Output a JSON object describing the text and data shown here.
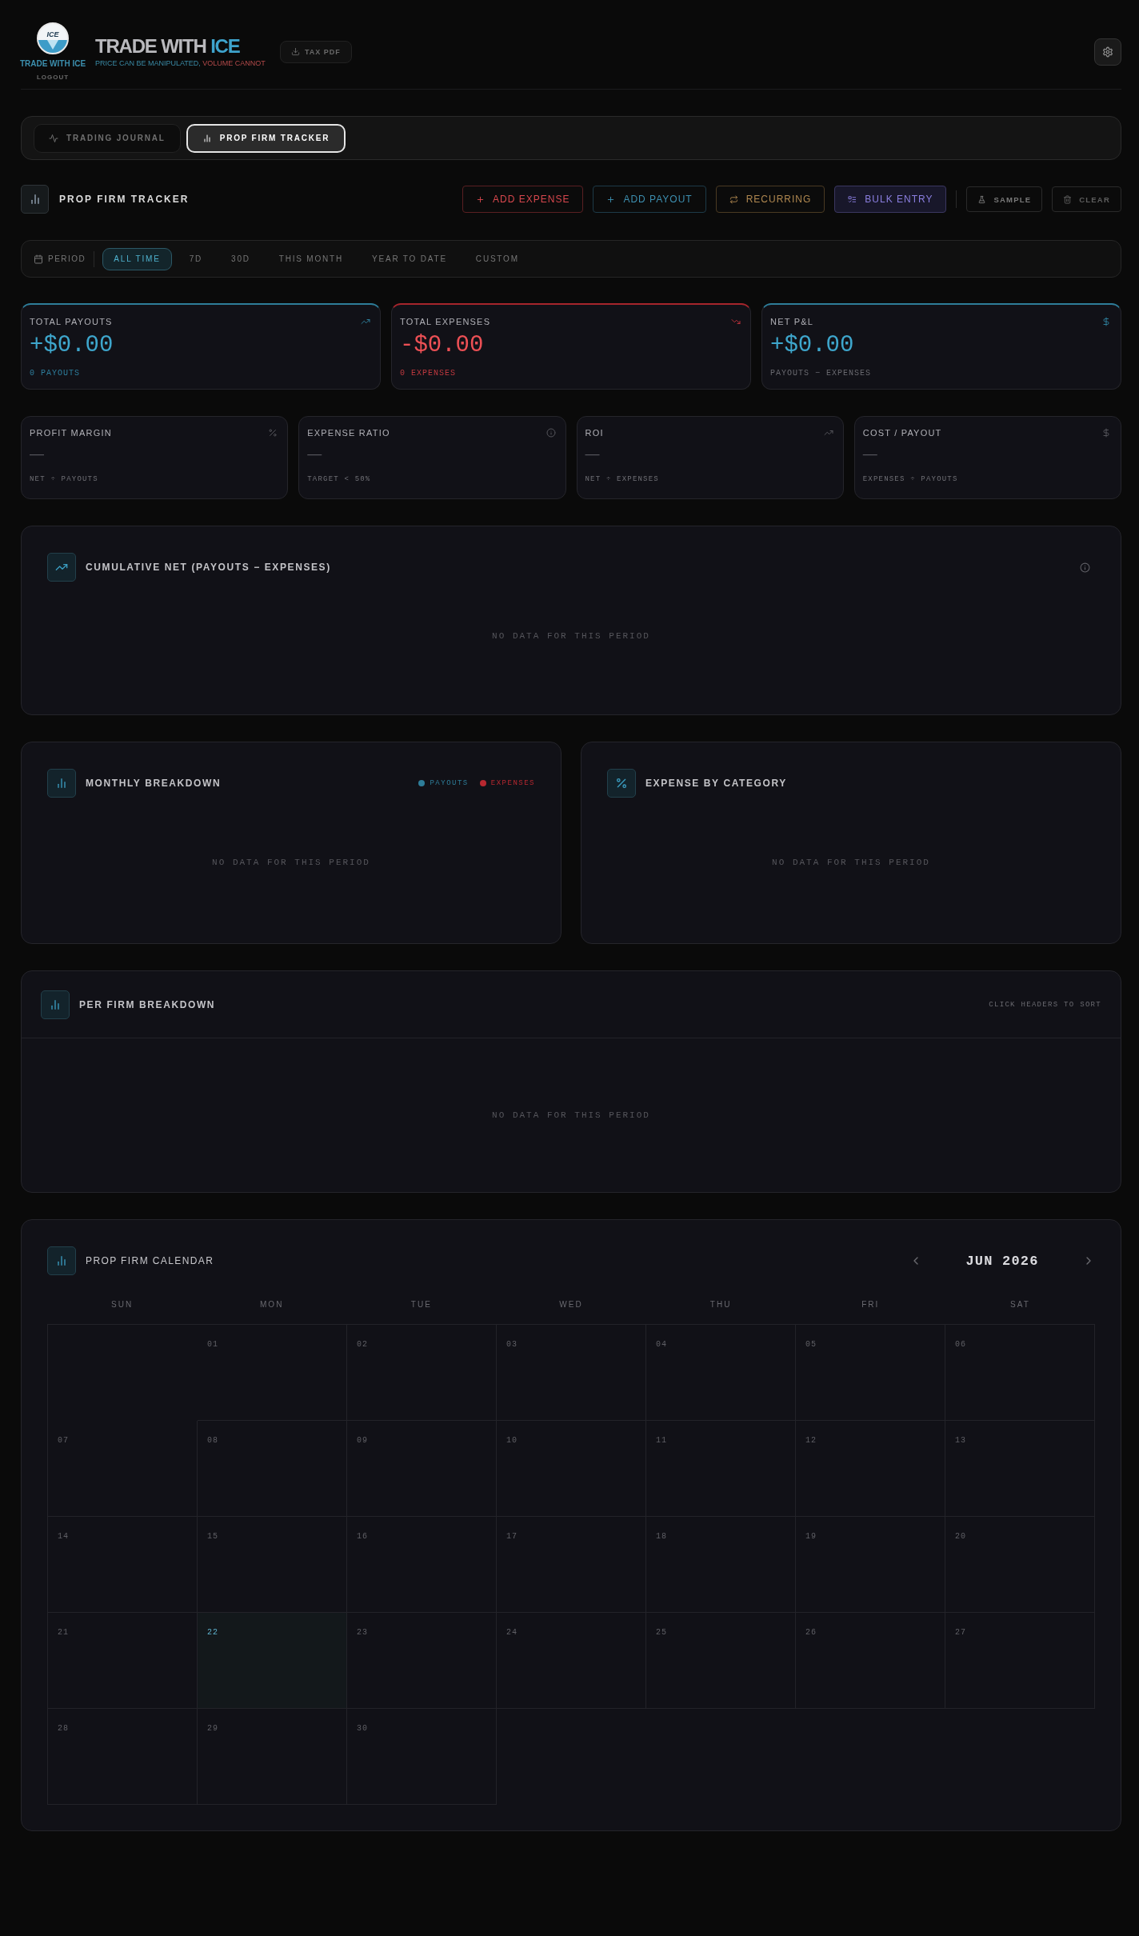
{
  "header": {
    "logo_text": "ICE",
    "brand_caption": "TRADE WITH ICE",
    "logout": "LOGOUT",
    "title": {
      "main": "TRADE WITH",
      "accent": "ICE"
    },
    "tagline": {
      "main": "PRICE CAN BE MANIPULATED,",
      "accent": "VOLUME CANNOT"
    },
    "tax_pdf": {
      "label": "TAX PDF",
      "disabled": true
    }
  },
  "tabs": [
    {
      "label": "TRADING JOURNAL",
      "selected": false
    },
    {
      "label": "PROP FIRM TRACKER",
      "selected": true
    }
  ],
  "toolbar": {
    "title": "PROP FIRM TRACKER",
    "actions": [
      {
        "label": "ADD EXPENSE",
        "kind": "expense"
      },
      {
        "label": "ADD PAYOUT",
        "kind": "payout"
      },
      {
        "label": "RECURRING",
        "kind": "recurring"
      },
      {
        "label": "BULK ENTRY",
        "kind": "bulk"
      },
      {
        "label": "SAMPLE",
        "kind": "sample"
      },
      {
        "label": "CLEAR",
        "kind": "clear"
      }
    ]
  },
  "period": {
    "label": "PERIOD",
    "options": [
      {
        "label": "ALL TIME",
        "selected": true
      },
      {
        "label": "7D",
        "selected": false
      },
      {
        "label": "30D",
        "selected": false
      },
      {
        "label": "THIS MONTH",
        "selected": false
      },
      {
        "label": "YEAR TO DATE",
        "selected": false
      },
      {
        "label": "CUSTOM",
        "selected": false
      }
    ]
  },
  "summary_cards": [
    {
      "label": "TOTAL PAYOUTS",
      "value": "+$0.00",
      "note": "0 PAYOUTS",
      "kind": "payout"
    },
    {
      "label": "TOTAL EXPENSES",
      "value": "-$0.00",
      "note": "0 EXPENSES",
      "kind": "expense"
    },
    {
      "label": "NET P&L",
      "value": "+$0.00",
      "note": "PAYOUTS − EXPENSES",
      "kind": "net"
    }
  ],
  "metric_cards": [
    {
      "label": "PROFIT MARGIN",
      "value": "—",
      "note": "NET ÷ PAYOUTS"
    },
    {
      "label": "EXPENSE RATIO",
      "value": "—",
      "note": "TARGET < 50%"
    },
    {
      "label": "ROI",
      "value": "—",
      "note": "NET ÷ EXPENSES"
    },
    {
      "label": "COST / PAYOUT",
      "value": "—",
      "note": "EXPENSES ÷ PAYOUTS"
    }
  ],
  "cumulative_net": {
    "title": "CUMULATIVE NET (PAYOUTS − EXPENSES)",
    "empty_message": "NO DATA FOR THIS PERIOD"
  },
  "monthly_breakdown": {
    "title": "MONTHLY BREAKDOWN",
    "legend": [
      {
        "label": "PAYOUTS",
        "color": "#2e7d99"
      },
      {
        "label": "EXPENSES",
        "color": "#b82830"
      }
    ],
    "empty_message": "NO DATA FOR THIS PERIOD"
  },
  "expense_by_category": {
    "title": "EXPENSE BY CATEGORY",
    "empty_message": "NO DATA FOR THIS PERIOD"
  },
  "per_firm_breakdown": {
    "title": "PER FIRM BREAKDOWN",
    "hint": "CLICK HEADERS TO SORT",
    "empty_message": "NO DATA FOR THIS PERIOD"
  },
  "calendar": {
    "title": "PROP FIRM CALENDAR",
    "month": "JUN 2026",
    "weekdays": [
      "SUN",
      "MON",
      "TUE",
      "WED",
      "THU",
      "FRI",
      "SAT"
    ],
    "weeks": [
      {
        "days": [
          {
            "kind": "blank"
          },
          {
            "kind": "day",
            "label": "01",
            "today": false
          },
          {
            "kind": "day",
            "label": "02",
            "today": false
          },
          {
            "kind": "day",
            "label": "03",
            "today": false
          },
          {
            "kind": "day",
            "label": "04",
            "today": false
          },
          {
            "kind": "day",
            "label": "05",
            "today": false
          },
          {
            "kind": "day",
            "label": "06",
            "today": false
          }
        ]
      },
      {
        "days": [
          {
            "kind": "day",
            "label": "07",
            "today": false
          },
          {
            "kind": "day",
            "label": "08",
            "today": false
          },
          {
            "kind": "day",
            "label": "09",
            "today": false
          },
          {
            "kind": "day",
            "label": "10",
            "today": false
          },
          {
            "kind": "day",
            "label": "11",
            "today": false
          },
          {
            "kind": "day",
            "label": "12",
            "today": false
          },
          {
            "kind": "day",
            "label": "13",
            "today": false
          }
        ]
      },
      {
        "days": [
          {
            "kind": "day",
            "label": "14",
            "today": false
          },
          {
            "kind": "day",
            "label": "15",
            "today": false
          },
          {
            "kind": "day",
            "label": "16",
            "today": false
          },
          {
            "kind": "day",
            "label": "17",
            "today": false
          },
          {
            "kind": "day",
            "label": "18",
            "today": false
          },
          {
            "kind": "day",
            "label": "19",
            "today": false
          },
          {
            "kind": "day",
            "label": "20",
            "today": false
          }
        ]
      },
      {
        "days": [
          {
            "kind": "day",
            "label": "21",
            "today": false
          },
          {
            "kind": "day",
            "label": "22",
            "today": true
          },
          {
            "kind": "day",
            "label": "23",
            "today": false
          },
          {
            "kind": "day",
            "label": "24",
            "today": false
          },
          {
            "kind": "day",
            "label": "25",
            "today": false
          },
          {
            "kind": "day",
            "label": "26",
            "today": false
          },
          {
            "kind": "day",
            "label": "27",
            "today": false
          }
        ]
      },
      {
        "days": [
          {
            "kind": "day",
            "label": "28",
            "today": false
          },
          {
            "kind": "day",
            "label": "29",
            "today": false
          },
          {
            "kind": "day",
            "label": "30",
            "today": false
          },
          {
            "kind": "blank"
          },
          {
            "kind": "blank"
          },
          {
            "kind": "blank"
          },
          {
            "kind": "blank"
          }
        ]
      }
    ]
  }
}
